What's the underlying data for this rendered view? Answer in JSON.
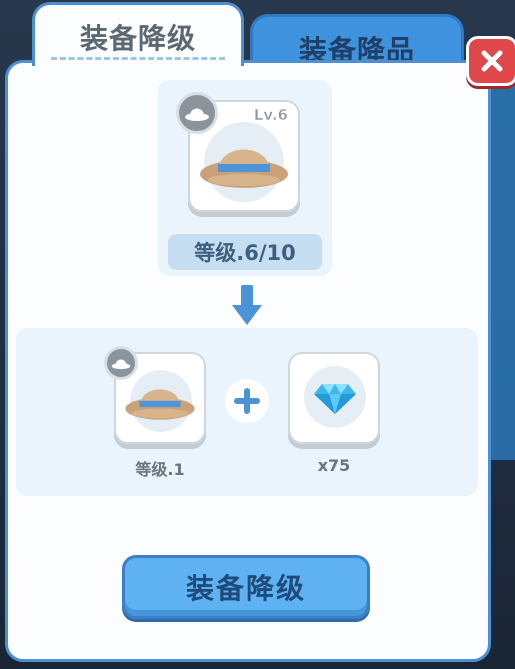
{
  "tabs": [
    {
      "label": "装备降级",
      "active": true
    },
    {
      "label": "装备降品",
      "active": false
    }
  ],
  "current_item": {
    "icon": "straw-hat-icon",
    "level_tag": "Lv.6",
    "level_text": "等级.6/10"
  },
  "materials": [
    {
      "icon": "straw-hat-icon",
      "label": "等级.1"
    },
    {
      "icon": "blue-diamond-icon",
      "label": "x75"
    }
  ],
  "action_button": {
    "label": "装备降级"
  },
  "colors": {
    "accent": "#4d8fd3",
    "button": "#5eb2f2",
    "close": "#e0474a",
    "panel": "#fbfdff"
  }
}
